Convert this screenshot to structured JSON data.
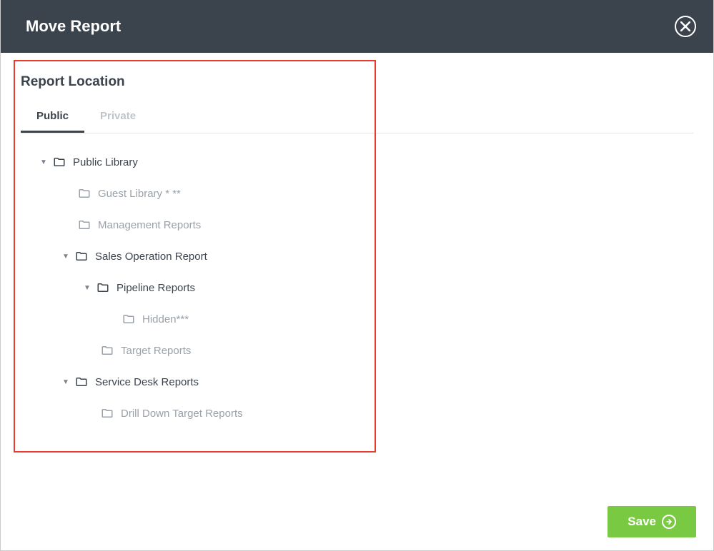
{
  "header": {
    "title": "Move Report"
  },
  "section": {
    "title": "Report Location"
  },
  "tabs": {
    "public": "Public",
    "private": "Private"
  },
  "tree": {
    "n0": "Public Library",
    "n1": "Guest Library * **",
    "n2": "Management Reports",
    "n3": "Sales Operation Report",
    "n4": "Pipeline Reports",
    "n5": "Hidden***",
    "n6": "Target Reports",
    "n7": "Service Desk Reports",
    "n8": "Drill Down Target Reports"
  },
  "footer": {
    "save": "Save"
  }
}
